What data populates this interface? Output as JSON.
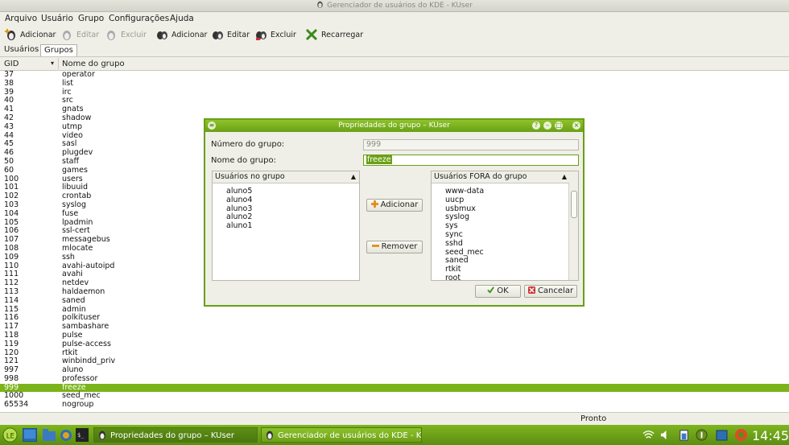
{
  "window_title": "Gerenciador de usuários do KDE - KUser",
  "menu": [
    "Arquivo",
    "Usuário",
    "Grupo",
    "Configurações",
    "Ajuda"
  ],
  "toolbar": {
    "user_add": "Adicionar",
    "user_edit": "Editar",
    "user_delete": "Excluir",
    "group_add": "Adicionar",
    "group_edit": "Editar",
    "group_delete": "Excluir",
    "reload": "Recarregar"
  },
  "tabs": [
    "Usuários",
    "Grupos"
  ],
  "columns": {
    "gid": "GID",
    "name": "Nome do grupo"
  },
  "groups": [
    {
      "gid": "37",
      "name": "operator"
    },
    {
      "gid": "38",
      "name": "list"
    },
    {
      "gid": "39",
      "name": "irc"
    },
    {
      "gid": "40",
      "name": "src"
    },
    {
      "gid": "41",
      "name": "gnats"
    },
    {
      "gid": "42",
      "name": "shadow"
    },
    {
      "gid": "43",
      "name": "utmp"
    },
    {
      "gid": "44",
      "name": "video"
    },
    {
      "gid": "45",
      "name": "sasl"
    },
    {
      "gid": "46",
      "name": "plugdev"
    },
    {
      "gid": "50",
      "name": "staff"
    },
    {
      "gid": "60",
      "name": "games"
    },
    {
      "gid": "100",
      "name": "users"
    },
    {
      "gid": "101",
      "name": "libuuid"
    },
    {
      "gid": "102",
      "name": "crontab"
    },
    {
      "gid": "103",
      "name": "syslog"
    },
    {
      "gid": "104",
      "name": "fuse"
    },
    {
      "gid": "105",
      "name": "lpadmin"
    },
    {
      "gid": "106",
      "name": "ssl-cert"
    },
    {
      "gid": "107",
      "name": "messagebus"
    },
    {
      "gid": "108",
      "name": "mlocate"
    },
    {
      "gid": "109",
      "name": "ssh"
    },
    {
      "gid": "110",
      "name": "avahi-autoipd"
    },
    {
      "gid": "111",
      "name": "avahi"
    },
    {
      "gid": "112",
      "name": "netdev"
    },
    {
      "gid": "113",
      "name": "haldaemon"
    },
    {
      "gid": "114",
      "name": "saned"
    },
    {
      "gid": "115",
      "name": "admin"
    },
    {
      "gid": "116",
      "name": "polkituser"
    },
    {
      "gid": "117",
      "name": "sambashare"
    },
    {
      "gid": "118",
      "name": "pulse"
    },
    {
      "gid": "119",
      "name": "pulse-access"
    },
    {
      "gid": "120",
      "name": "rtkit"
    },
    {
      "gid": "121",
      "name": "winbindd_priv"
    },
    {
      "gid": "997",
      "name": "aluno"
    },
    {
      "gid": "998",
      "name": "professor"
    },
    {
      "gid": "999",
      "name": "freeze"
    },
    {
      "gid": "1000",
      "name": "seed_mec"
    },
    {
      "gid": "65534",
      "name": "nogroup"
    }
  ],
  "selected_gid": "999",
  "status": "Pronto",
  "dialog": {
    "title": "Propriedades do grupo – KUser",
    "number_label": "Número do grupo:",
    "number_value": "999",
    "name_label": "Nome do grupo:",
    "name_value": "freeze",
    "in_group_header": "Usuários no grupo",
    "in_group": [
      "aluno5",
      "aluno4",
      "aluno3",
      "aluno2",
      "aluno1"
    ],
    "out_group_header": "Usuários FORA do grupo",
    "out_group": [
      "www-data",
      "uucp",
      "usbmux",
      "syslog",
      "sys",
      "sync",
      "sshd",
      "seed_mec",
      "saned",
      "rtkit",
      "root"
    ],
    "add_button": "Adicionar",
    "remove_button": "Remover",
    "ok_button": "OK",
    "cancel_button": "Cancelar"
  },
  "taskbar": {
    "tasks": [
      "Propriedades do grupo – KUser",
      "Gerenciador de usuários do KDE - KUser"
    ],
    "clock": "14:45"
  },
  "colors": {
    "accent": "#7bb31a",
    "taskbar": "#6ea017"
  }
}
